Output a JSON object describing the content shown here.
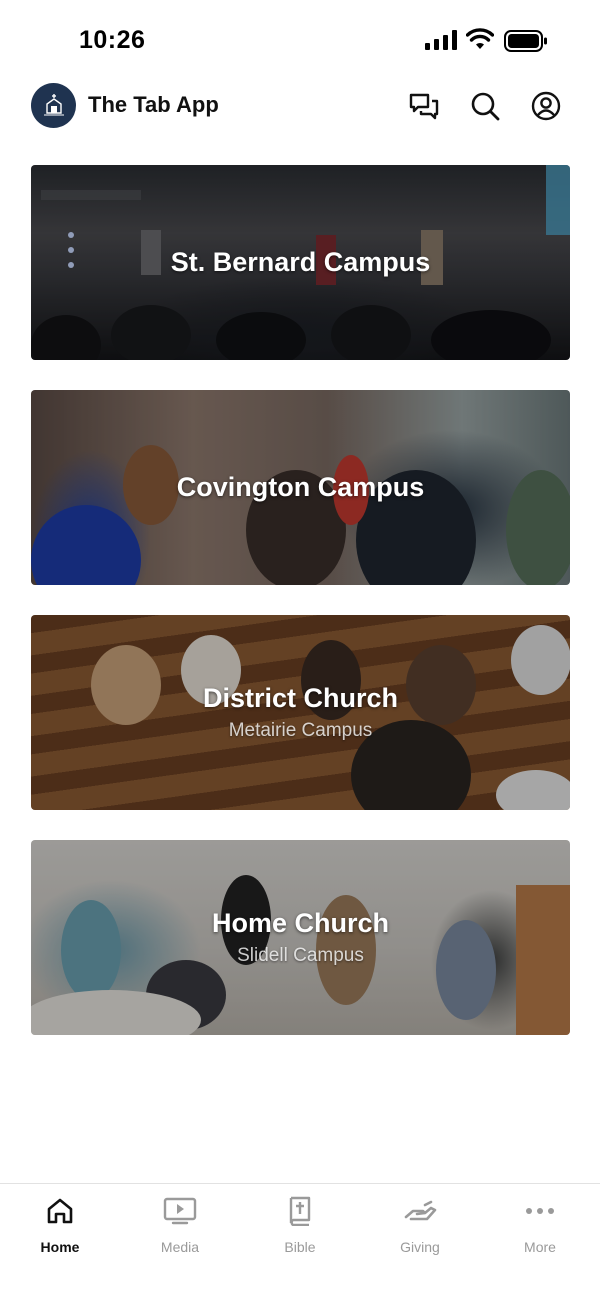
{
  "status_bar": {
    "time": "10:26"
  },
  "header": {
    "app_title": "The Tab App"
  },
  "campuses": [
    {
      "title": "St. Bernard Campus",
      "subtitle": ""
    },
    {
      "title": "Covington Campus",
      "subtitle": ""
    },
    {
      "title": "District Church",
      "subtitle": "Metairie Campus"
    },
    {
      "title": "Home Church",
      "subtitle": "Slidell Campus"
    }
  ],
  "tabs": [
    {
      "label": "Home",
      "icon": "home-icon",
      "active": true
    },
    {
      "label": "Media",
      "icon": "play-screen-icon",
      "active": false
    },
    {
      "label": "Bible",
      "icon": "bible-icon",
      "active": false
    },
    {
      "label": "Giving",
      "icon": "giving-hand-icon",
      "active": false
    },
    {
      "label": "More",
      "icon": "more-dots-icon",
      "active": false
    }
  ],
  "colors": {
    "logo_bg": "#1f3350",
    "active_tab": "#111111",
    "inactive_tab": "#9a9a9a"
  }
}
